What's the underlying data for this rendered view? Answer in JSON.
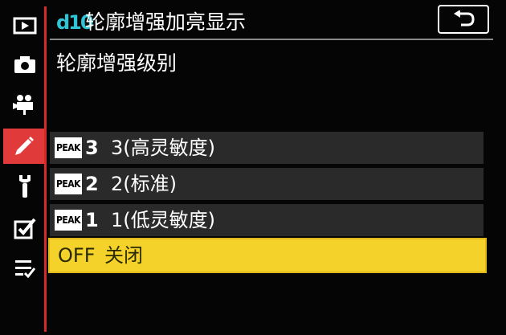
{
  "menu": {
    "section_code": "d10",
    "title": "轮廓增强加亮显示",
    "subtitle": "轮廓增强级别"
  },
  "sidebar": {
    "items": [
      {
        "name": "playback-icon",
        "active": false
      },
      {
        "name": "camera-icon",
        "active": false
      },
      {
        "name": "movie-camera-icon",
        "active": false
      },
      {
        "name": "pencil-icon",
        "active": true
      },
      {
        "name": "wrench-icon",
        "active": false
      },
      {
        "name": "checkbox-edit-icon",
        "active": false
      },
      {
        "name": "my-menu-icon",
        "active": false
      }
    ]
  },
  "options": [
    {
      "badge": "PEAK",
      "level": "3",
      "label": "3(高灵敏度)",
      "selected": false
    },
    {
      "badge": "PEAK",
      "level": "2",
      "label": "2(标准)",
      "selected": false
    },
    {
      "badge": "PEAK",
      "level": "1",
      "label": "1(低灵敏度)",
      "selected": false
    },
    {
      "badge": "OFF",
      "label": "关闭",
      "selected": true
    }
  ],
  "colors": {
    "accent_red": "#e03a3a",
    "highlight_yellow": "#f4d22a",
    "code_cyan": "#2fc5d6",
    "row_gray": "#2a2a2a"
  }
}
